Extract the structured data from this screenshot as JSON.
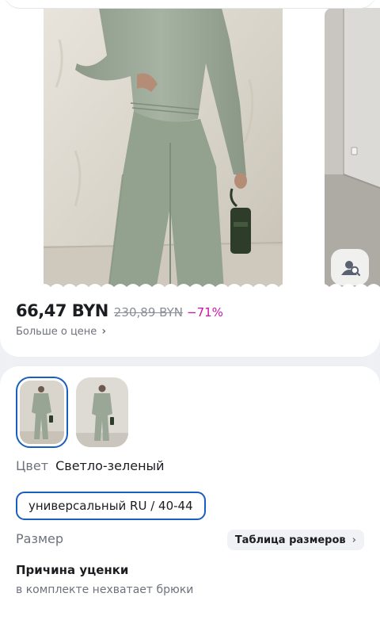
{
  "gallery": {
    "main_photo": "woman-in-sage-knit-sweater-and-wide-pants",
    "next_photo": "room-corner-concrete-floor",
    "mute_icon": "speaker-muted-icon",
    "photo_search_icon": "image-search-icon"
  },
  "price": {
    "current": "66,47 BYN",
    "old": "230,89 BYN",
    "discount": "−71%",
    "more_label": "Больше о цене",
    "more_chevron": "›",
    "discount_color": "#cb11ab"
  },
  "options": {
    "color_label": "Цвет",
    "color_value": "Светло-зеленый",
    "size_selected": "универсальный RU / 40-44",
    "size_label": "Размер",
    "size_table_label": "Таблица размеров",
    "size_table_chevron": "›",
    "accent_color": "#1a5fbd"
  },
  "markdown": {
    "title": "Причина уценки",
    "text": "в комплекте нехватает брюки"
  }
}
